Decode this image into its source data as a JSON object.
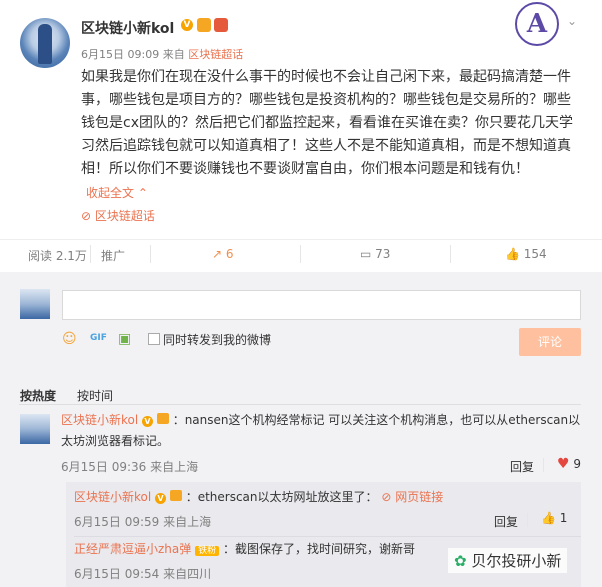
{
  "post": {
    "author": "区块链小新kol",
    "time": "6月15日 09:09",
    "from_label": "来自",
    "source": "区块链超话",
    "content": "如果我是你们在现在没什么事干的时候也不会让自己闲下来，最起码搞清楚一件事，哪些钱包是项目方的？哪些钱包是投资机构的？哪些钱包是交易所的？哪些钱包是cx团队的？然后把它们都监控起来，看看谁在买谁在卖？你只要花几天学习然后追踪钱包就可以知道真相了！这些人不是不能知道真相，而是不想知道真相！所以你们不要谈赚钱也不要谈财富自由，你们根本问题是和钱有仇！",
    "expand_label": "收起全文",
    "topic_label": "区块链超话"
  },
  "actions": {
    "read": "阅读 2.1万",
    "promote": "推广",
    "share_count": "6",
    "comment_count": "73",
    "like_count": "154"
  },
  "composer": {
    "also_share_label": "同时转发到我的微博",
    "submit_label": "评论"
  },
  "sort": {
    "hot": "按热度",
    "time": "按时间"
  },
  "comments": [
    {
      "author": "区块链小新kol",
      "text": "：nansen这个机构经常标记 可以关注这个机构消息，也可以从etherscan以太坊浏览器看标记。",
      "time": "6月15日 09:36 来自上海",
      "reply_label": "回复",
      "likes": "9"
    }
  ],
  "replies": [
    {
      "author": "区块链小新kol",
      "text": "：etherscan以太坊网址放这里了：",
      "link_label": "网页链接",
      "time": "6月15日 09:59 来自上海",
      "reply_label": "回复",
      "likes": "1"
    },
    {
      "author": "正经严肃逗逼小zha弹",
      "fan_badge": "铁粉",
      "text": "：截图保存了，找时间研究，谢新哥",
      "time": "6月15日 09:54 来自四川"
    }
  ],
  "watermark": "贝尔投研小新"
}
